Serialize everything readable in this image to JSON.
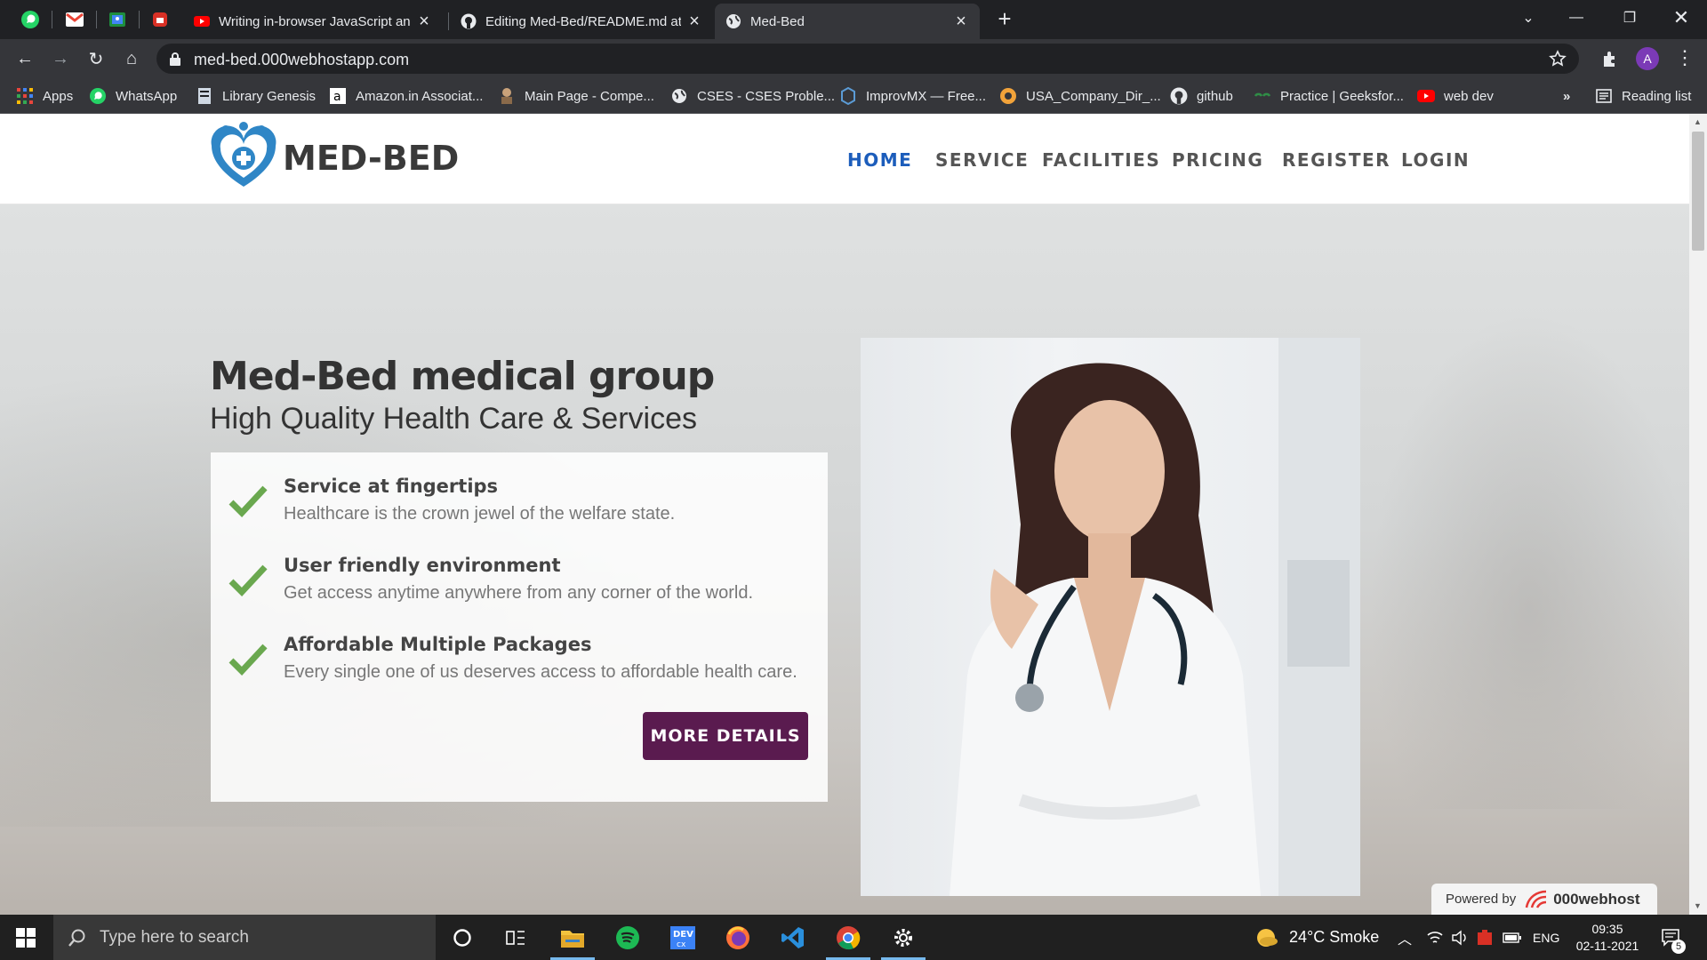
{
  "browser": {
    "tabs": [
      {
        "label": "Writing in-browser JavaScript and",
        "favicon": "youtube-icon"
      },
      {
        "label": "Editing Med-Bed/README.md at",
        "favicon": "github-icon"
      },
      {
        "label": "Med-Bed",
        "favicon": "globe-icon",
        "active": true
      }
    ],
    "url": "med-bed.000webhostapp.com",
    "profile_initial": "A",
    "bookmarks": [
      "Apps",
      "WhatsApp",
      "Library Genesis",
      "Amazon.in Associat...",
      "Main Page - Compe...",
      "CSES - CSES Proble...",
      "ImprovMX — Free...",
      "USA_Company_Dir_...",
      "github",
      "Practice | Geeksfor...",
      "web dev"
    ],
    "bookmarks_overflow": "»",
    "reading_list": "Reading list"
  },
  "site": {
    "brand": "MED-BED",
    "nav": [
      "HOME",
      "SERVICE",
      "FACILITIES",
      "PRICING",
      "REGISTER",
      "LOGIN"
    ],
    "nav_active": "HOME",
    "hero": {
      "title": "Med-Bed medical group",
      "subtitle": "High Quality Health Care & Services",
      "features": [
        {
          "title": "Service at fingertips",
          "desc": "Healthcare is the crown jewel of the welfare state."
        },
        {
          "title": "User friendly environment",
          "desc": "Get access anytime anywhere from any corner of the world."
        },
        {
          "title": "Affordable Multiple Packages",
          "desc": "Every single one of us deserves access to affordable health care."
        }
      ],
      "button": "MORE DETAILS"
    },
    "powered_by": {
      "label": "Powered by",
      "brand": "000webhost"
    }
  },
  "taskbar": {
    "search_placeholder": "Type here to search",
    "weather": "24°C  Smoke",
    "language": "ENG",
    "time": "09:35",
    "date": "02-11-2021",
    "notification_count": "5"
  },
  "colors": {
    "accent_nav": "#1c5dbb",
    "button": "#5a1b4f",
    "check": "#6aa84f",
    "logo_blue": "#2f86c6"
  }
}
